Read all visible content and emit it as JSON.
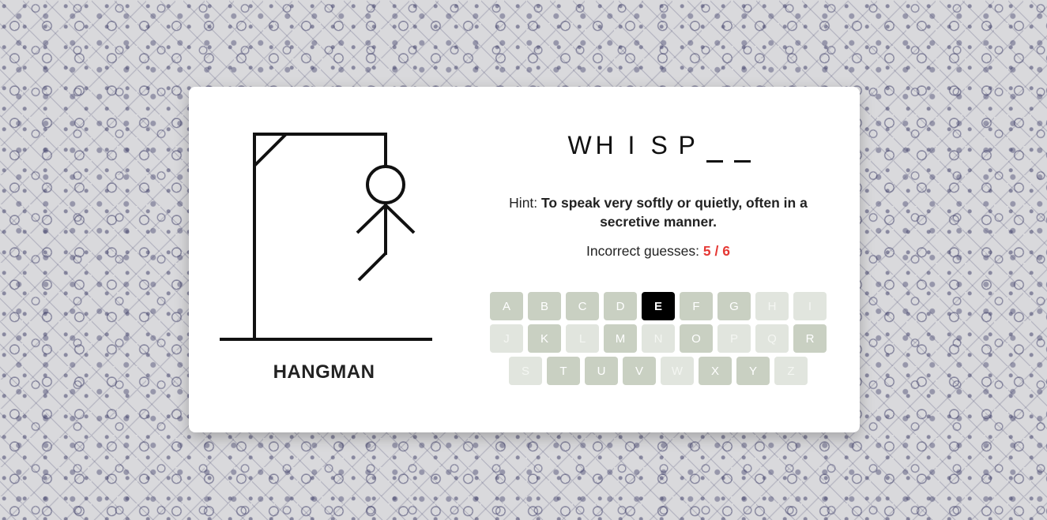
{
  "game": {
    "title": "HANGMAN",
    "word": [
      "W",
      "H",
      "I",
      "S",
      "P",
      "",
      ""
    ],
    "hint_label": "Hint:",
    "hint_text": "To speak very softly or quietly, often in a secretive manner.",
    "guesses_label": "Incorrect guesses:",
    "guesses_count": "5 / 6"
  },
  "keyboard": {
    "rows": [
      [
        {
          "letter": "A",
          "state": "available"
        },
        {
          "letter": "B",
          "state": "available"
        },
        {
          "letter": "C",
          "state": "available"
        },
        {
          "letter": "D",
          "state": "available"
        },
        {
          "letter": "E",
          "state": "active"
        },
        {
          "letter": "F",
          "state": "available"
        },
        {
          "letter": "G",
          "state": "available"
        },
        {
          "letter": "H",
          "state": "used"
        },
        {
          "letter": "I",
          "state": "used"
        }
      ],
      [
        {
          "letter": "J",
          "state": "used"
        },
        {
          "letter": "K",
          "state": "available"
        },
        {
          "letter": "L",
          "state": "used"
        },
        {
          "letter": "M",
          "state": "available"
        },
        {
          "letter": "N",
          "state": "used"
        },
        {
          "letter": "O",
          "state": "available"
        },
        {
          "letter": "P",
          "state": "used"
        },
        {
          "letter": "Q",
          "state": "used"
        },
        {
          "letter": "R",
          "state": "available"
        }
      ],
      [
        {
          "letter": "S",
          "state": "used"
        },
        {
          "letter": "T",
          "state": "available"
        },
        {
          "letter": "U",
          "state": "available"
        },
        {
          "letter": "V",
          "state": "available"
        },
        {
          "letter": "W",
          "state": "used"
        },
        {
          "letter": "X",
          "state": "available"
        },
        {
          "letter": "Y",
          "state": "available"
        },
        {
          "letter": "Z",
          "state": "used"
        }
      ]
    ]
  },
  "colors": {
    "key_available": "#c9d0c2",
    "key_used": "#e1e5de",
    "key_active": "#000000",
    "guess_count": "#e53935"
  }
}
